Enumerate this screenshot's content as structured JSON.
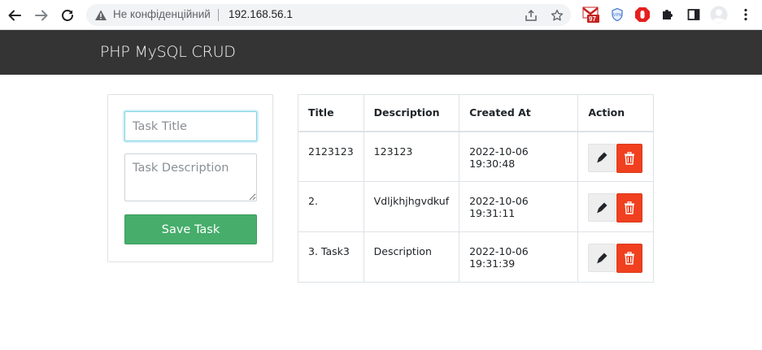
{
  "browser": {
    "security_label": "Не конфіденційний",
    "url": "192.168.56.1",
    "gmail_badge": "97"
  },
  "navbar": {
    "brand": "PHP MySQL CRUD"
  },
  "form": {
    "title_placeholder": "Task Title",
    "description_placeholder": "Task Description",
    "save_label": "Save Task"
  },
  "table": {
    "headers": [
      "Title",
      "Description",
      "Created At",
      "Action"
    ],
    "rows": [
      {
        "title": "2123123",
        "description": "123123",
        "created_at": "2022-10-06 19:30:48"
      },
      {
        "title": "2.",
        "description": "Vdljkhjhgvdkuf",
        "created_at": "2022-10-06 19:31:11"
      },
      {
        "title": "3. Task3",
        "description": "Description",
        "created_at": "2022-10-06 19:31:39"
      }
    ]
  },
  "colors": {
    "navbar_bg": "#343434",
    "save_button": "#46ad6b",
    "delete_button": "#f0401f",
    "edit_button": "#eeeeee"
  }
}
